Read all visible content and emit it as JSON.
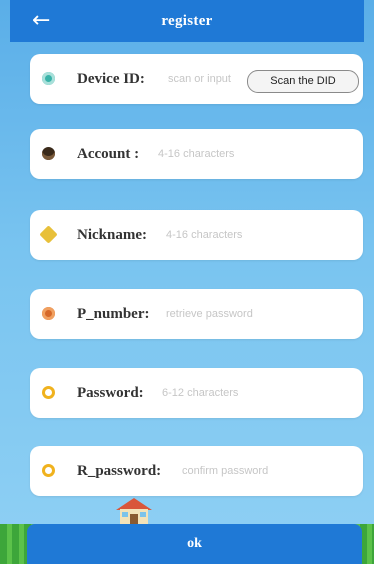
{
  "header": {
    "title": "register",
    "back_icon": "arrow-left-icon",
    "background": "#1f79d6"
  },
  "form": {
    "device_id": {
      "label": "Device ID:",
      "placeholder": "scan or input",
      "icon": "device-icon",
      "icon_color": "#39b2a8",
      "scan_button": "Scan the DID"
    },
    "account": {
      "label": "Account :",
      "placeholder": "4-16 characters",
      "icon": "account-icon",
      "icon_color": "#3a2a1a"
    },
    "nickname": {
      "label": "Nickname:",
      "placeholder": "4-16 characters",
      "icon": "nickname-icon",
      "icon_color": "#e8c03a"
    },
    "phone": {
      "label": "P_number:",
      "placeholder": "retrieve password",
      "icon": "phone-icon",
      "icon_color": "#d6692a"
    },
    "password": {
      "label": "Password:",
      "placeholder": "6-12 characters",
      "icon": "lock-icon",
      "icon_color": "#f0b21e"
    },
    "repeat_password": {
      "label": "R_password:",
      "placeholder": "confirm password",
      "icon": "lock-icon",
      "icon_color": "#f0b21e"
    }
  },
  "footer": {
    "ok_label": "ok",
    "ok_color": "#1f79d6",
    "decoration": "house-icon"
  }
}
